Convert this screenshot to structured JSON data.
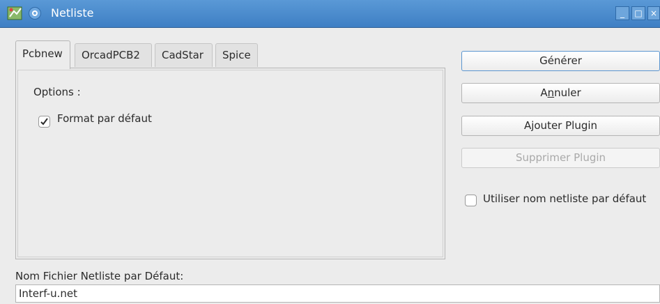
{
  "window": {
    "title": "Netliste",
    "icons": {
      "app": "pcb-app-icon",
      "menu": "window-menu-icon",
      "minimize": "minimize-icon",
      "maximize": "maximize-icon",
      "close": "close-icon"
    },
    "minimize_glyph": "_",
    "maximize_glyph": "□",
    "close_glyph": "×"
  },
  "tabs": [
    {
      "label": "Pcbnew",
      "active": true
    },
    {
      "label": "OrcadPCB2",
      "active": false
    },
    {
      "label": "CadStar",
      "active": false
    },
    {
      "label": "Spice",
      "active": false
    }
  ],
  "pcbnew_panel": {
    "options_label": "Options :",
    "format_checkbox": {
      "label": "Format par défaut",
      "checked": true
    }
  },
  "buttons": {
    "generate": "Générer",
    "cancel_prefix": "A",
    "cancel_mnemonic": "n",
    "cancel_suffix": "nuler",
    "add_plugin": "Ajouter Plugin",
    "remove_plugin": "Supprimer Plugin"
  },
  "use_default_name": {
    "label": "Utiliser nom netliste par défaut",
    "checked": false
  },
  "default_filename": {
    "label": "Nom Fichier Netliste par Défaut:",
    "value": "Interf-u.net"
  },
  "colors": {
    "titlebar": "#4a8ccd",
    "default_button_border": "#5b95cf",
    "disabled_text": "#a9a9a9"
  }
}
